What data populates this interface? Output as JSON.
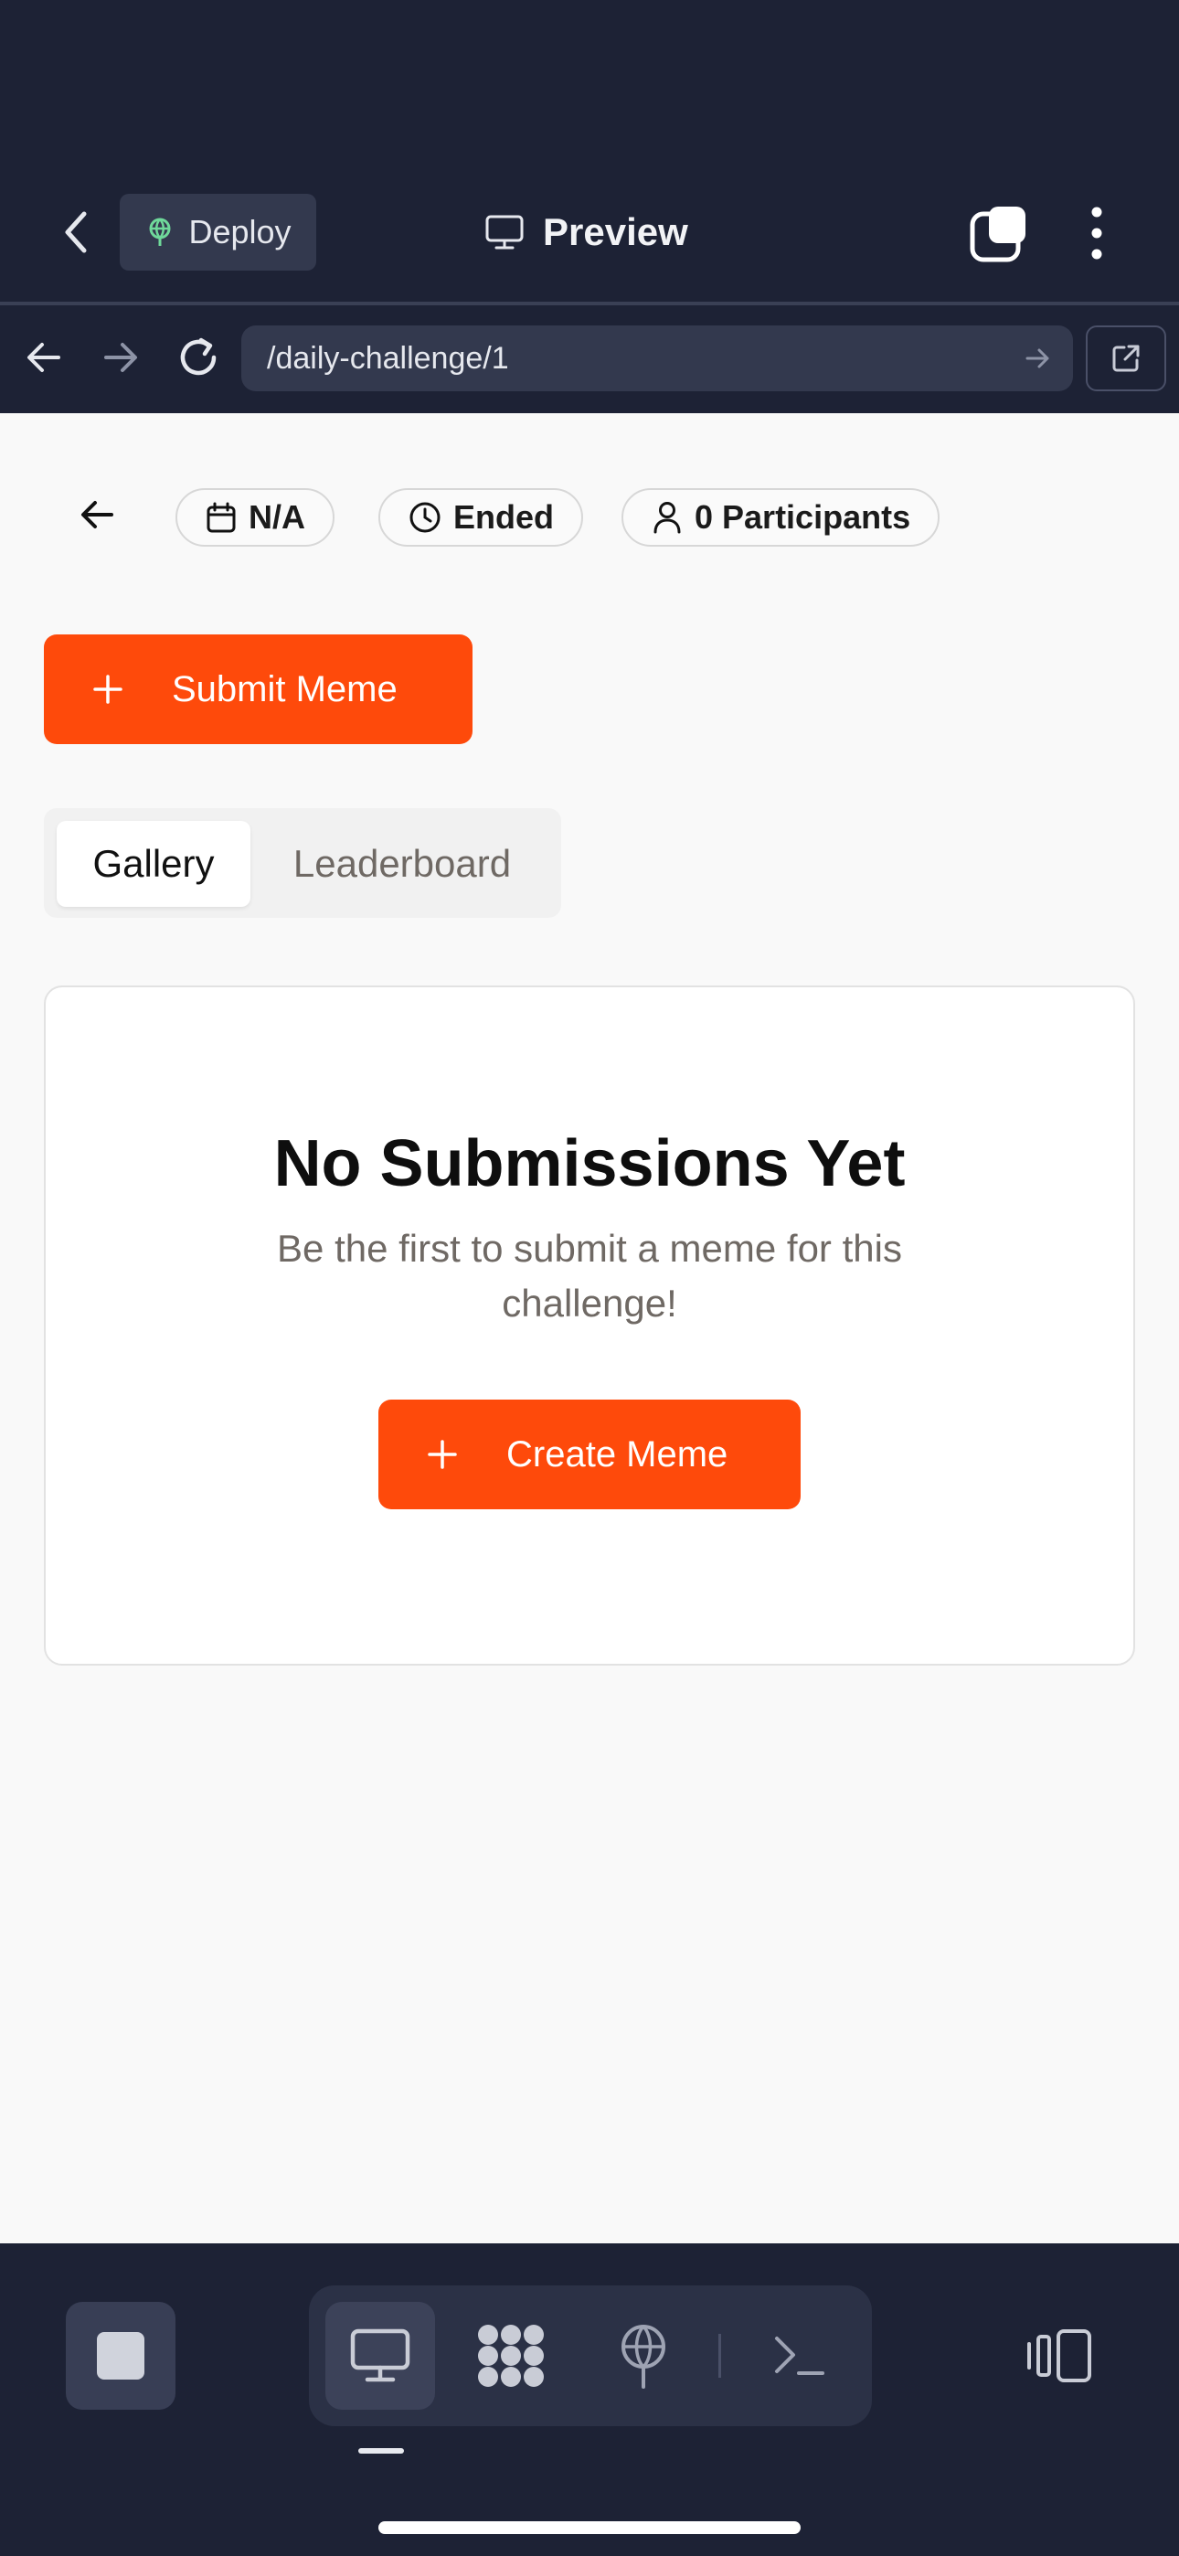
{
  "topbar": {
    "deploy_label": "Deploy",
    "title": "Preview",
    "icons": {
      "back": "chevron-left-icon",
      "deploy": "globe-tree-icon",
      "preview": "monitor-icon",
      "tabs": "tabs-icon",
      "menu": "kebab-menu-icon"
    }
  },
  "browser": {
    "url": "/daily-challenge/1",
    "icons": [
      "arrow-left-icon",
      "arrow-right-icon",
      "reload-icon",
      "arrow-right-icon",
      "external-link-icon"
    ]
  },
  "page": {
    "chips": {
      "date": "N/A",
      "status": "Ended",
      "participants": "0 Participants"
    },
    "submit_label": "Submit Meme",
    "tabs": [
      {
        "label": "Gallery",
        "active": true
      },
      {
        "label": "Leaderboard",
        "active": false
      }
    ],
    "empty_state": {
      "title": "No Submissions Yet",
      "description": "Be the first to submit a meme for this challenge!",
      "cta_label": "Create Meme"
    }
  },
  "dock": {
    "items": [
      "stop-icon",
      "monitor-icon",
      "apps-icon",
      "deploy-icon",
      "terminal-icon",
      "layout-icon"
    ],
    "active": "monitor-icon"
  },
  "colors": {
    "chrome_bg": "#1d2235",
    "accent": "#fe4a0b",
    "deploy_icon": "#6fd99a",
    "content_bg": "#f9f9f9"
  }
}
